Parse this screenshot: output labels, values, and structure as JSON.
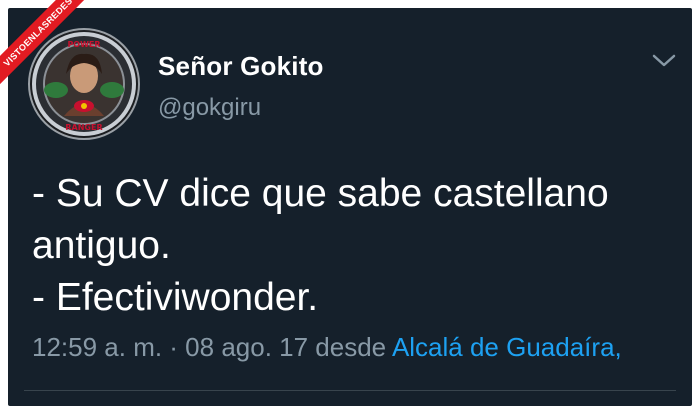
{
  "watermark": {
    "text": "VISTOENLASREDES"
  },
  "tweet": {
    "display_name": "Señor Gokito",
    "handle": "@gokgiru",
    "avatar_icon": "power-rangers-coin-avatar",
    "avatar_lettering": [
      "POWER",
      "RANGER"
    ],
    "menu_icon": "chevron-down-icon",
    "text_lines": [
      "- Su CV dice que sabe castellano",
      "antiguo.",
      "- Efectiviwonder."
    ],
    "time": "12:59 a. m. · 08 ago. 17 desde",
    "place": "Alcalá de Guadaíra,"
  },
  "colors": {
    "background": "#15202b",
    "text": "#ffffff",
    "secondary": "#8899a6",
    "link": "#1da1f2",
    "divider": "#38444d",
    "watermark": "#e21b22"
  }
}
